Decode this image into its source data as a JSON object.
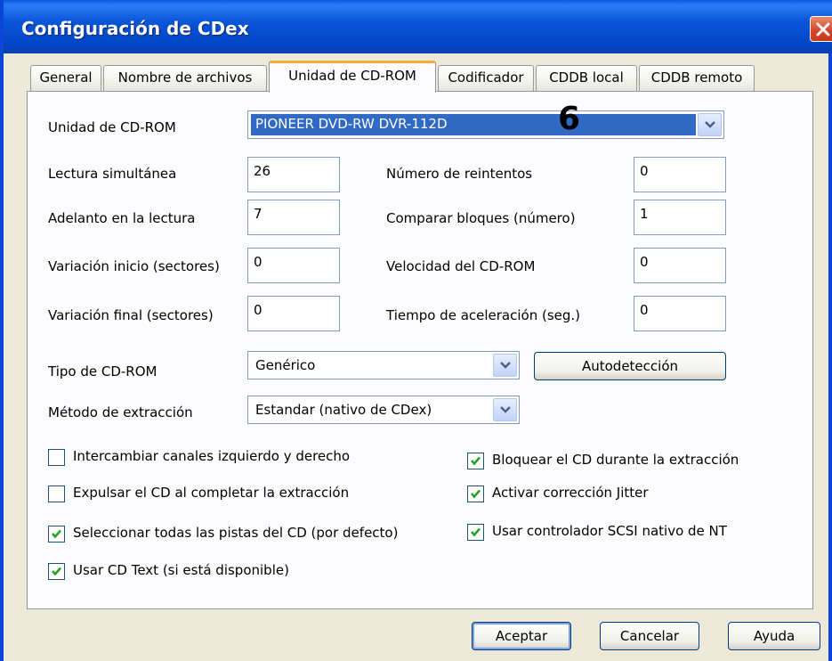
{
  "window": {
    "title": "Configuración de CDex"
  },
  "tabs": [
    {
      "label": "General"
    },
    {
      "label": "Nombre de archivos"
    },
    {
      "label": "Unidad de CD-ROM"
    },
    {
      "label": "Codificador"
    },
    {
      "label": "CDDB local"
    },
    {
      "label": "CDDB remoto"
    }
  ],
  "active_tab": "Unidad de CD-ROM",
  "drive": {
    "label": "Unidad de CD-ROM",
    "selected": "PIONEER DVD-RW  DVR-112D",
    "annotation": "6"
  },
  "fields": {
    "lectura_simultanea": {
      "label": "Lectura simultánea",
      "value": "26"
    },
    "adelanto": {
      "label": "Adelanto en la lectura",
      "value": "7"
    },
    "variacion_inicio": {
      "label": "Variación inicio (sectores)",
      "value": "0"
    },
    "variacion_final": {
      "label": "Variación final (sectores)",
      "value": "0"
    },
    "reintentos": {
      "label": "Número de reintentos",
      "value": "0"
    },
    "comparar": {
      "label": "Comparar bloques (número)",
      "value": "1"
    },
    "velocidad": {
      "label": "Velocidad del CD-ROM",
      "value": "0"
    },
    "aceleracion": {
      "label": "Tiempo de aceleración (seg.)",
      "value": "0"
    }
  },
  "tipo": {
    "label": "Tipo de CD-ROM",
    "selected": "Genérico"
  },
  "autodeteccion": "Autodetección",
  "metodo": {
    "label": "Método de extracción",
    "selected": "Estandar (nativo de CDex)"
  },
  "checkboxes": {
    "intercambiar": {
      "label": "Intercambiar canales izquierdo y derecho",
      "checked": false
    },
    "expulsar": {
      "label": "Expulsar el CD al completar la extracción",
      "checked": false
    },
    "seleccionar": {
      "label": "Seleccionar todas las pistas del CD (por defecto)",
      "checked": true
    },
    "cdtext": {
      "label": "Usar CD Text (si está disponible)",
      "checked": true
    },
    "bloquear": {
      "label": "Bloquear el CD durante la extracción",
      "checked": true
    },
    "jitter": {
      "label": "Activar corrección Jitter",
      "checked": true
    },
    "scsi": {
      "label": "Usar controlador SCSI nativo de NT",
      "checked": true
    }
  },
  "buttons": {
    "ok": "Aceptar",
    "cancel": "Cancelar",
    "help": "Ayuda"
  },
  "colors": {
    "titlebar": "#0a55d8",
    "selection": "#316ac5",
    "close": "#d8432a"
  }
}
